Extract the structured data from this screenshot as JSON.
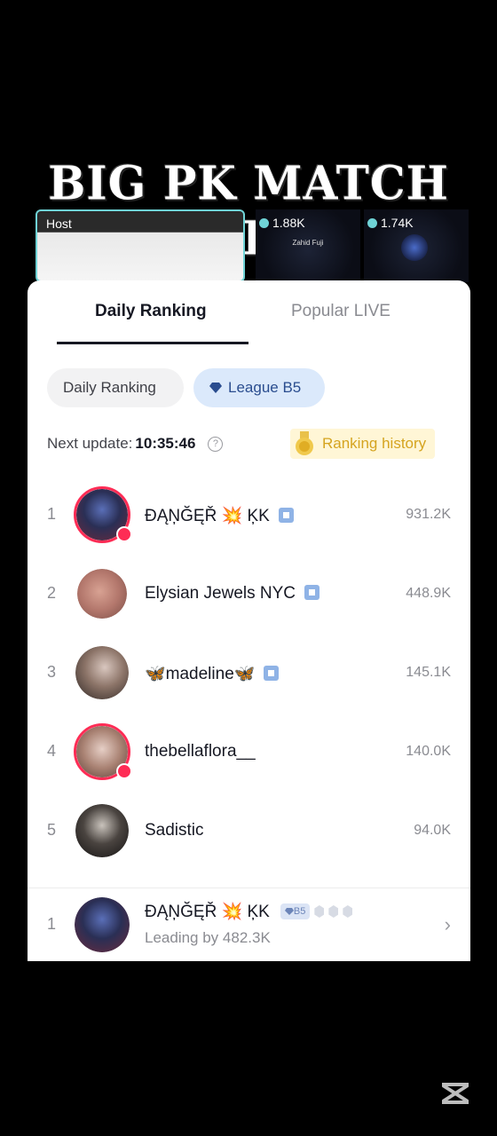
{
  "banner": {
    "text": "BIG PK MATCH WIN"
  },
  "live_strip": {
    "host_label": "Host",
    "guests": [
      {
        "coins": "1.88K",
        "name": "Zahid Fuji"
      },
      {
        "coins": "1.74K"
      }
    ]
  },
  "tabs": [
    {
      "label": "Daily Ranking",
      "active": true
    },
    {
      "label": "Popular LIVE",
      "active": false
    }
  ],
  "filters": {
    "daily_label": "Daily Ranking",
    "league_label": "League B5"
  },
  "update": {
    "label": "Next update:",
    "time": "10:35:46",
    "help_icon": "?"
  },
  "history_button": {
    "label": "Ranking history"
  },
  "rankings": [
    {
      "rank": "1",
      "name": "ĐĄŅĞĘŘ 💥 ĶK",
      "score": "931.2K",
      "live": true,
      "shield": true
    },
    {
      "rank": "2",
      "name": "Elysian Jewels NYC",
      "score": "448.9K",
      "live": false,
      "shield": true
    },
    {
      "rank": "3",
      "name": "🦋madeline🦋",
      "score": "145.1K",
      "live": false,
      "shield": true
    },
    {
      "rank": "4",
      "name": "thebellaflora__",
      "score": "140.0K",
      "live": true,
      "shield": false
    },
    {
      "rank": "5",
      "name": "Sadistic",
      "score": "94.0K",
      "live": false,
      "shield": false
    }
  ],
  "current_user": {
    "rank": "1",
    "name": "ĐĄŅĞĘŘ 💥 ĶK",
    "league_tag": "B5",
    "lead_text": "Leading by 482.3K"
  },
  "colors": {
    "accent_live": "#fe2c55",
    "league_blue": "#dbe9fb",
    "history_gold": "#d5a420"
  }
}
